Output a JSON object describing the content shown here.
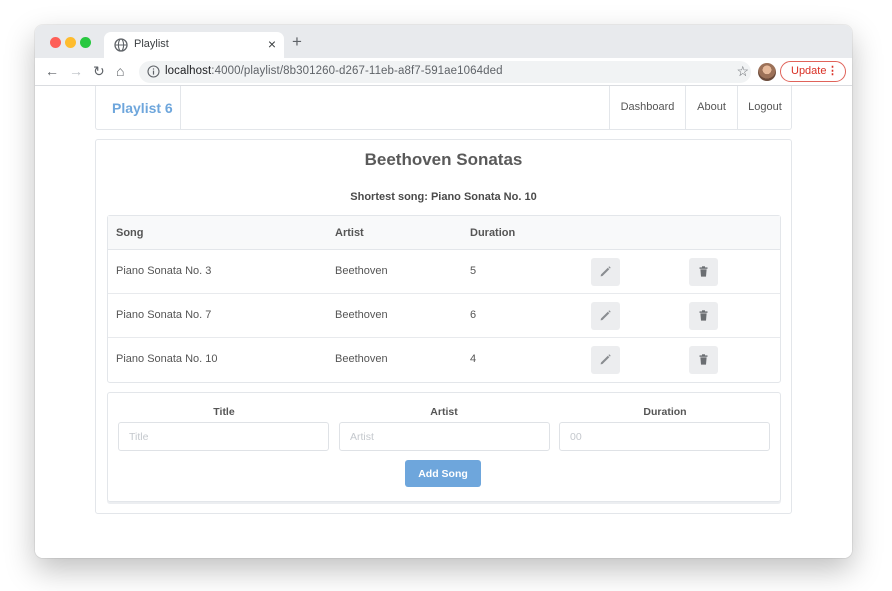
{
  "browser": {
    "tab_title": "Playlist",
    "tab_close": "×",
    "new_tab": "+",
    "url_host": "localhost",
    "url_rest": ":4000/playlist/8b301260-d267-11eb-a8f7-591ae1064ded",
    "update_label": "Update",
    "update_menu": "⋮",
    "back": "←",
    "forward": "→",
    "reload": "↻",
    "home": "⌂",
    "star": "☆"
  },
  "nav": {
    "brand": "Playlist 6",
    "links": [
      "Dashboard",
      "About",
      "Logout"
    ]
  },
  "playlist": {
    "title": "Beethoven Sonatas",
    "shortest": "Shortest song: Piano Sonata No. 10"
  },
  "table": {
    "headers": [
      "Song",
      "Artist",
      "Duration"
    ],
    "rows": [
      {
        "song": "Piano Sonata No. 3",
        "artist": "Beethoven",
        "duration": "5"
      },
      {
        "song": "Piano Sonata No. 7",
        "artist": "Beethoven",
        "duration": "6"
      },
      {
        "song": "Piano Sonata No. 10",
        "artist": "Beethoven",
        "duration": "4"
      }
    ]
  },
  "form": {
    "title_label": "Title",
    "title_placeholder": "Title",
    "artist_label": "Artist",
    "artist_placeholder": "Artist",
    "duration_label": "Duration",
    "duration_placeholder": "00",
    "submit_label": "Add Song"
  },
  "colors": {
    "accent": "#6ea6dc",
    "update_red": "#d93025"
  }
}
